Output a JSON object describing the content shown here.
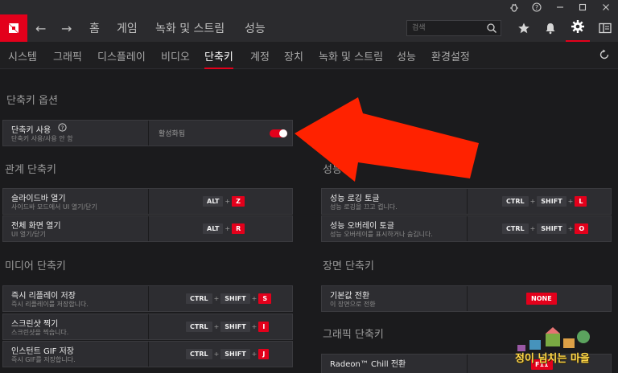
{
  "window": {
    "icons": [
      "bug-icon",
      "help-icon",
      "minimize-icon",
      "restore-icon",
      "close-icon"
    ]
  },
  "nav": {
    "back": "←",
    "forward": "→",
    "links": [
      "홈",
      "게임",
      "녹화 및 스트림",
      "성능"
    ],
    "search_placeholder": "검색"
  },
  "tabs": [
    "시스템",
    "그래픽",
    "디스플레이",
    "비디오",
    "단축키",
    "계정",
    "장치",
    "녹화 및 스트림",
    "성능",
    "환경설정"
  ],
  "active_tab": "단축키",
  "options": {
    "title": "단축키 옵션",
    "row": {
      "label": "단축키 사용",
      "help": "?",
      "sub": "단축키 사용/사용 안 함",
      "value": "활성화됨",
      "enabled": true
    }
  },
  "related": {
    "title": "관계 단축키",
    "rows": [
      {
        "label": "슬라이드바 열기",
        "sub": "사이드바 모드에서 UI 열기/닫기",
        "keys": [
          "ALT"
        ],
        "key": "Z"
      },
      {
        "label": "전체 화면 열기",
        "sub": "UI 열기/닫기",
        "keys": [
          "ALT"
        ],
        "key": "R"
      }
    ]
  },
  "perf": {
    "title_partial": "성능",
    "rows": [
      {
        "label": "성능 로깅 토글",
        "sub": "성능 로깅을 끄고 켭니다.",
        "keys": [
          "CTRL",
          "SHIFT"
        ],
        "key": "L"
      },
      {
        "label": "성능 오버레이 토글",
        "sub": "성능 오버레이를 표시하거나 숨깁니다.",
        "keys": [
          "CTRL",
          "SHIFT"
        ],
        "key": "O"
      }
    ]
  },
  "media": {
    "title": "미디어 단축키",
    "rows": [
      {
        "label": "즉시 리플레이 저장",
        "sub": "즉시 리플레이를 저장합니다.",
        "keys": [
          "CTRL",
          "SHIFT"
        ],
        "key": "S"
      },
      {
        "label": "스크린샷 찍기",
        "sub": "스크린샷을 찍습니다.",
        "keys": [
          "CTRL",
          "SHIFT"
        ],
        "key": "I"
      },
      {
        "label": "인스턴트 GIF 저장",
        "sub": "즉시 GIF를 저장합니다.",
        "keys": [
          "CTRL",
          "SHIFT"
        ],
        "key": "J"
      }
    ]
  },
  "scene": {
    "title": "장면 단축키",
    "rows": [
      {
        "label": "기본값 전환",
        "sub": "이 장면으로 전환",
        "value": "NONE"
      }
    ]
  },
  "graphics": {
    "title": "그래픽 단축키",
    "rows": [
      {
        "label": "Radeon™ Chill 전환",
        "key": "F11"
      }
    ]
  },
  "watermark": {
    "text": "정이 넘치는 마을"
  },
  "colors": {
    "accent": "#e3001b",
    "arrow": "#ff2200"
  }
}
